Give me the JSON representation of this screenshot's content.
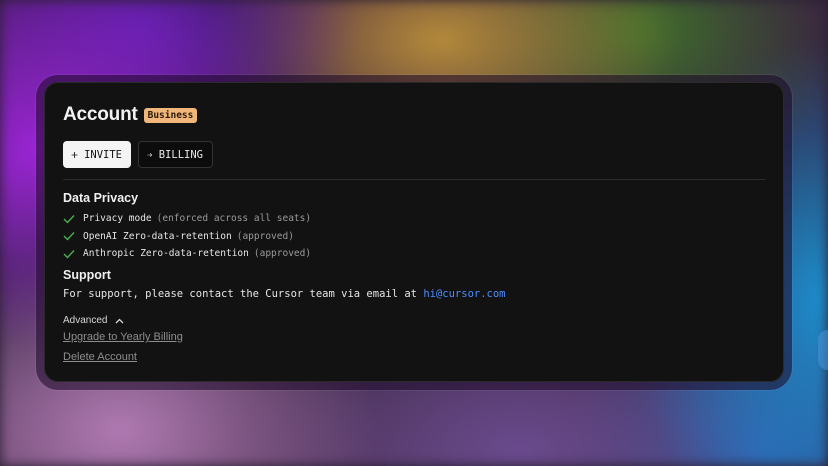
{
  "account": {
    "title": "Account",
    "plan_badge": "Business"
  },
  "actions": {
    "invite_label": "INVITE",
    "billing_label": "BILLING"
  },
  "data_privacy": {
    "heading": "Data Privacy",
    "items": [
      {
        "label": "Privacy mode",
        "note": "(enforced across all seats)"
      },
      {
        "label": "OpenAI Zero-data-retention",
        "note": "(approved)"
      },
      {
        "label": "Anthropic Zero-data-retention",
        "note": "(approved)"
      }
    ],
    "check_color": "#4caf50"
  },
  "support": {
    "heading": "Support",
    "text": "For support, please contact the Cursor team via email at ",
    "email": "hi@cursor.com",
    "email_color": "#4f8cff"
  },
  "advanced": {
    "label": "Advanced",
    "upgrade_link": "Upgrade to Yearly Billing",
    "delete_link": "Delete Account"
  },
  "colors": {
    "badge_bg": "#f1b77a",
    "panel_bg": "#121212"
  }
}
